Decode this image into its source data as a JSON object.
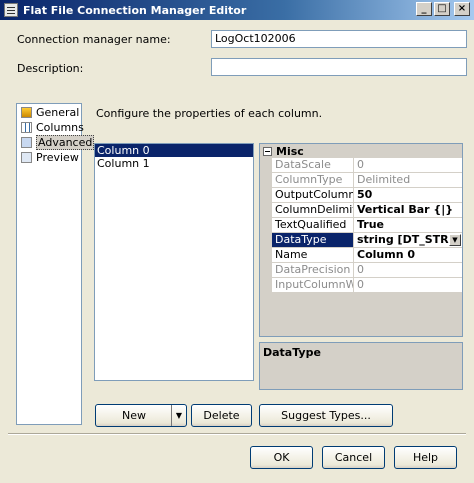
{
  "window": {
    "title": "Flat File Connection Manager Editor",
    "minimize": "_",
    "maximize": "□",
    "close": "×"
  },
  "form": {
    "name_label": "Connection manager name:",
    "name_value": "LogOct102006",
    "description_label": "Description:",
    "description_value": ""
  },
  "nav": {
    "items": [
      {
        "label": "General",
        "icon": "general-icon"
      },
      {
        "label": "Columns",
        "icon": "columns-icon"
      },
      {
        "label": "Advanced",
        "icon": "advanced-icon",
        "selected": true
      },
      {
        "label": "Preview",
        "icon": "preview-icon"
      }
    ]
  },
  "main": {
    "instruction": "Configure the properties of each column.",
    "columns": [
      "Column 0",
      "Column 1"
    ],
    "selected_column": "Column 0"
  },
  "properties": {
    "category": "Misc",
    "rows": [
      {
        "name": "DataScale",
        "value": "0",
        "disabled": true
      },
      {
        "name": "ColumnType",
        "value": "Delimited",
        "disabled": true
      },
      {
        "name": "OutputColumnWid",
        "value": "50",
        "bold": true
      },
      {
        "name": "ColumnDelimiter",
        "value": "Vertical Bar {|}",
        "bold": true
      },
      {
        "name": "TextQualified",
        "value": "True",
        "bold": true
      },
      {
        "name": "DataType",
        "value": "string [DT_STR]",
        "bold": true,
        "selected": true
      },
      {
        "name": "Name",
        "value": "Column 0",
        "bold": true
      },
      {
        "name": "DataPrecision",
        "value": "0",
        "disabled": true
      },
      {
        "name": "InputColumnWidth",
        "value": "0",
        "disabled": true
      }
    ],
    "description_title": "DataType"
  },
  "buttons": {
    "new": "New",
    "new_arrow": "▼",
    "delete": "Delete",
    "suggest": "Suggest Types...",
    "ok": "OK",
    "cancel": "Cancel",
    "help": "Help"
  },
  "colors": {
    "selection": "#0a246a",
    "face": "#ece9d8"
  }
}
